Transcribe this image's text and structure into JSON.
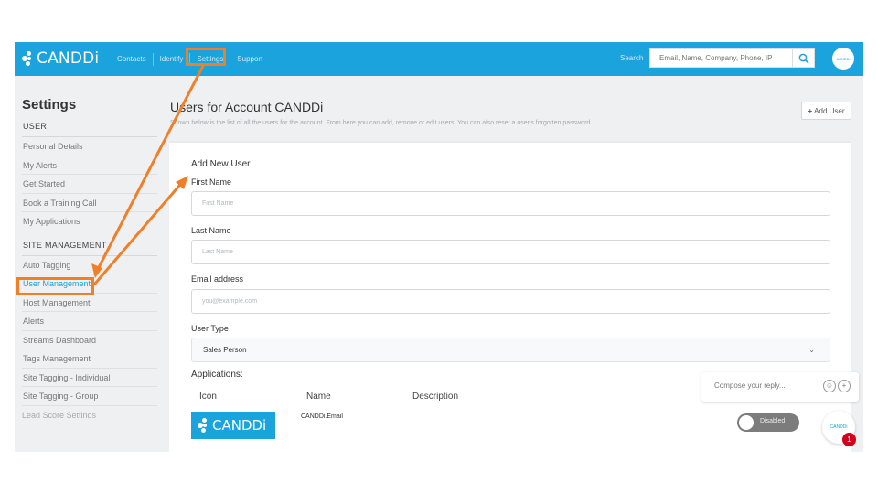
{
  "brand": {
    "name": "CANDDi",
    "color": "#1ba3de"
  },
  "nav": {
    "items": [
      "Contacts",
      "Identify",
      "Settings",
      "Support"
    ]
  },
  "search": {
    "label": "Search",
    "placeholder": "Email, Name, Company, Phone, IP",
    "icon": "search-icon"
  },
  "account_avatar": {
    "label": "CANDDi"
  },
  "sidebar": {
    "title": "Settings",
    "user_section": "USER",
    "user_items": [
      "Personal Details",
      "My Alerts",
      "Get Started",
      "Book a Training Call",
      "My Applications"
    ],
    "site_section": "SITE MANAGEMENT",
    "site_items": [
      "Auto Tagging",
      "User Management",
      "Host Management",
      "Alerts",
      "Streams Dashboard",
      "Tags Management",
      "Site Tagging - Individual",
      "Site Tagging - Group"
    ],
    "truncated_item": "Lead Score Settings",
    "active_item": "User Management"
  },
  "main": {
    "title": "Users for Account CANDDi",
    "subtitle": "Shown below is the list of all the users for the account. From here you can add, remove or edit users. You can also reset a user's forgotten password",
    "add_user_label": "Add User"
  },
  "form": {
    "heading": "Add New User",
    "first_name": {
      "label": "First Name",
      "placeholder": "First Name"
    },
    "last_name": {
      "label": "Last Name",
      "placeholder": "Last Name"
    },
    "email": {
      "label": "Email address",
      "placeholder": "you@example.com"
    },
    "user_type": {
      "label": "User Type",
      "value": "Sales Person"
    },
    "applications": {
      "label": "Applications:",
      "columns": [
        "Icon",
        "Name",
        "Description"
      ],
      "rows": [
        {
          "icon_text": "CANDDi",
          "name": "CANDDi.Email",
          "description": "",
          "status": "Disabled"
        }
      ]
    }
  },
  "chat": {
    "placeholder": "Compose your reply...",
    "launcher_label": "CANDDi",
    "badge_count": "1"
  },
  "annotation": {
    "color": "#f07f27"
  }
}
